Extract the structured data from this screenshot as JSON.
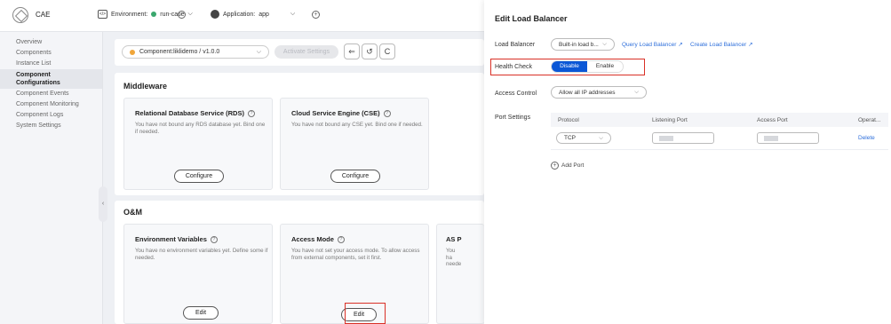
{
  "topbar": {
    "app_name": "CAE",
    "environment_label": "Environment:",
    "environment_value": "run-case",
    "application_label": "Application:",
    "application_value": "app"
  },
  "sidebar": {
    "items": [
      {
        "label": "Overview"
      },
      {
        "label": "Components"
      },
      {
        "label": "Instance List"
      },
      {
        "label": "Component Configurations",
        "active": true
      },
      {
        "label": "Component Events"
      },
      {
        "label": "Component Monitoring"
      },
      {
        "label": "Component Logs"
      },
      {
        "label": "System Settings"
      }
    ]
  },
  "main": {
    "component_select": "Component:liklidemo / v1.0.0",
    "activate_settings": "Activate Settings",
    "middleware_title": "Middleware",
    "rds_title": "Relational Database Service (RDS)",
    "rds_desc": "You have not bound any RDS database yet. Bind one if needed.",
    "rds_btn": "Configure",
    "cse_title": "Cloud Service Engine (CSE)",
    "cse_desc": "You have not bound any CSE yet. Bind one if needed.",
    "cse_btn": "Configure",
    "om_title": "O&M",
    "env_title": "Environment Variables",
    "env_desc": "You have no environment variables yet. Define some if needed.",
    "env_btn": "Edit",
    "access_title": "Access Mode",
    "access_desc": "You have not set your access mode. To allow access from external components, set it first.",
    "access_btn": "Edit",
    "as_title": "AS P",
    "as_desc": "You ha neede"
  },
  "panel": {
    "title": "Edit Load Balancer",
    "lb_label": "Load Balancer",
    "lb_value": "Built-in load b...",
    "query_link": "Query Load Balancer",
    "create_link": "Create Load Balancer",
    "hc_label": "Health Check",
    "hc_disable": "Disable",
    "hc_enable": "Enable",
    "ac_label": "Access Control",
    "ac_value": "Allow all IP addresses",
    "ps_label": "Port Settings",
    "table_headers": [
      "Protocol",
      "Listening Port",
      "Access Port",
      "Operat..."
    ],
    "row_protocol": "TCP",
    "row_delete": "Delete",
    "add_port": "Add Port"
  },
  "colors": {
    "accent": "#0a57d6",
    "link": "#2e6fdb",
    "highlight_box": "#d93026"
  }
}
